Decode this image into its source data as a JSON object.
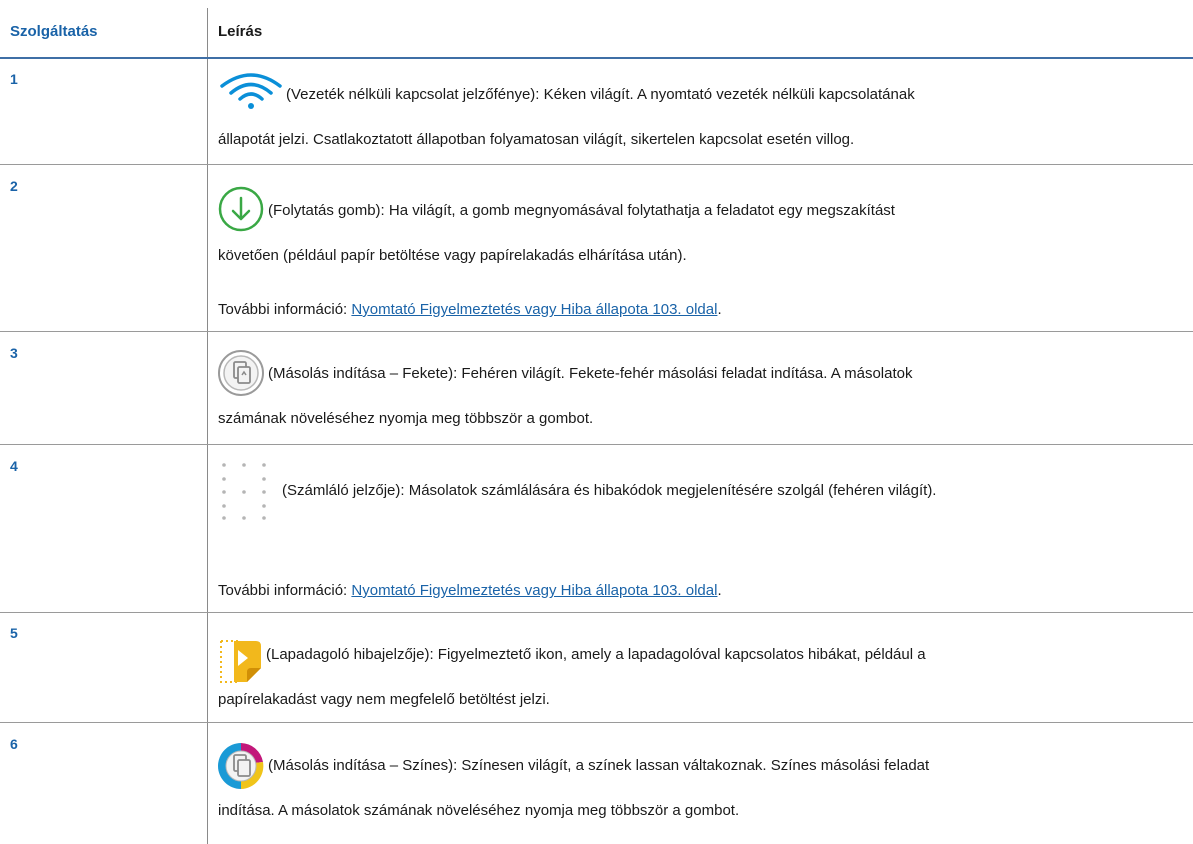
{
  "table": {
    "headers": {
      "service": "Szolgáltatás",
      "description": "Leírás"
    },
    "rows": [
      {
        "number": "1",
        "icon": "wifi-icon",
        "line1": "(Vezeték nélküli kapcsolat jelzőfénye): Kéken világít. A nyomtató vezeték nélküli kapcsolatának",
        "line2": "állapotát jelzi. Csatlakoztatott állapotban folyamatosan világít, sikertelen kapcsolat esetén villog."
      },
      {
        "number": "2",
        "icon": "resume-arrow-down-icon",
        "line1": "(Folytatás gomb): Ha világít, a gomb megnyomásával folytathatja a feladatot egy megszakítást",
        "line2": "követően (például papír betöltése vagy papírelakadás elhárítása után).",
        "more_label": "További információ: ",
        "more_link": "Nyomtató Figyelmeztetés vagy Hiba állapota 103. oldal",
        "more_suffix": "."
      },
      {
        "number": "3",
        "icon": "copy-black-icon",
        "line1": "(Másolás indítása – Fekete): Fehéren világít. Fekete-fehér másolási feladat indítása. A másolatok",
        "line2": "számának növeléséhez nyomja meg többször a gombot."
      },
      {
        "number": "4",
        "icon": "counter-dots-icon",
        "line1": "(Számláló jelzője): Másolatok számlálására és hibakódok megjelenítésére szolgál (fehéren világít).",
        "more_label": "További információ: ",
        "more_link": "Nyomtató Figyelmeztetés vagy Hiba állapota 103. oldal",
        "more_suffix": "."
      },
      {
        "number": "5",
        "icon": "feeder-error-icon",
        "line1": "(Lapadagoló hibajelzője): Figyelmeztető ikon, amely a lapadagolóval kapcsolatos hibákat, például a",
        "line2": "papírelakadást vagy nem megfelelő betöltést jelzi."
      },
      {
        "number": "6",
        "icon": "copy-color-icon",
        "line1": "(Másolás indítása – Színes): Színesen világít, a színek lassan váltakoznak. Színes másolási feladat",
        "line2": "indítása. A másolatok számának növeléséhez nyomja meg többször a gombot."
      }
    ]
  },
  "colors": {
    "header_blue": "#1a63a8",
    "rule_blue": "#3f6fa6",
    "wifi_blue": "#0a8fd8",
    "resume_green": "#3aa845",
    "feeder_yellow": "#f2b81c"
  }
}
